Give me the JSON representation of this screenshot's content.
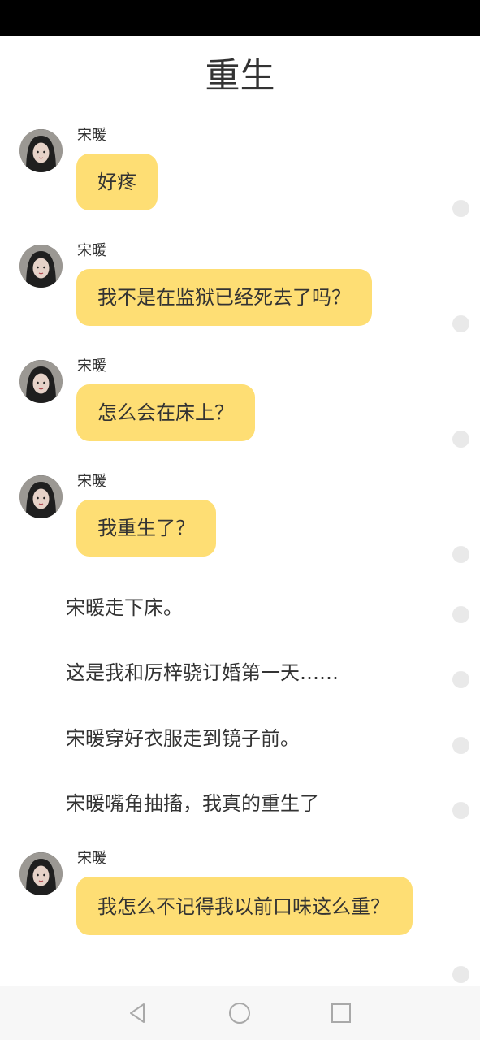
{
  "header": {
    "title": "重生"
  },
  "messages": [
    {
      "speaker": "宋暖",
      "text": "好疼"
    },
    {
      "speaker": "宋暖",
      "text": "我不是在监狱已经死去了吗？"
    },
    {
      "speaker": "宋暖",
      "text": "怎么会在床上？"
    },
    {
      "speaker": "宋暖",
      "text": "我重生了？"
    },
    {
      "speaker": "宋暖",
      "text": "我怎么不记得我以前口味这么重？"
    }
  ],
  "narration": [
    "宋暖走下床。",
    "这是我和厉梓骁订婚第一天……",
    "宋暖穿好衣服走到镜子前。",
    "宋暖嘴角抽搐，我真的重生了"
  ],
  "colors": {
    "bubble": "#fede74",
    "status_bar": "#000000",
    "nav_bar": "#f7f7f7",
    "dot": "#e9e9e9",
    "text": "#333333"
  },
  "navigation": {
    "back_icon": "triangle-back-icon",
    "home_icon": "circle-home-icon",
    "recents_icon": "square-recents-icon"
  }
}
